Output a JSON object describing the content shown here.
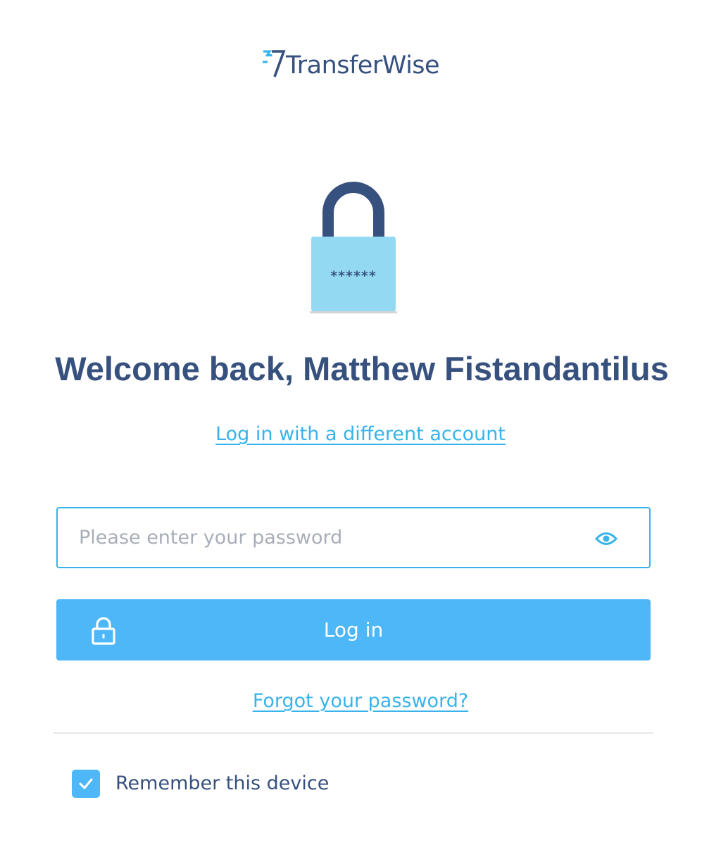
{
  "header": {
    "brand_name": "TransferWise",
    "logo_icon": "transferwise-flag-icon"
  },
  "hero": {
    "icon": "padlock-illustration-icon",
    "password_mask": "******"
  },
  "welcome": {
    "title": "Welcome back, Matthew Fistandantilus"
  },
  "links": {
    "different_account": "Log in with a different account",
    "forgot_password": "Forgot your password?"
  },
  "password": {
    "value": "",
    "placeholder": "Please enter your password",
    "toggle_icon": "eye-icon"
  },
  "login_button": {
    "label": "Log in",
    "icon": "lock-icon"
  },
  "remember": {
    "label": "Remember this device",
    "checked": true
  },
  "colors": {
    "brand_navy": "#37517e",
    "accent_blue": "#38b3eb",
    "button_blue": "#4eb7f7",
    "lock_body": "#94d9f2",
    "divider": "#e4e6ea",
    "placeholder": "#a8aeb8"
  }
}
